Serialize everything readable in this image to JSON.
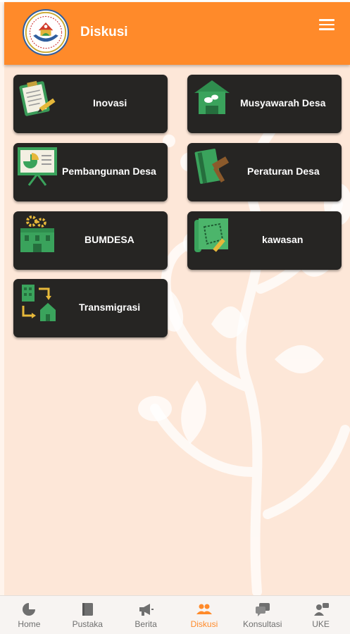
{
  "header": {
    "title": "Diskusi",
    "menu_icon": "hamburger-menu-icon",
    "logo_icon": "ministry-logo-icon"
  },
  "colors": {
    "accent": "#ff8a2a",
    "card_bg": "#262523",
    "page_bg": "#fde7d8",
    "nav_active": "#ff8a2a",
    "nav_inactive": "#6f6f6f"
  },
  "categories": [
    {
      "label": "Inovasi",
      "icon": "clipboard-pencil-icon"
    },
    {
      "label": "Musyawarah Desa",
      "icon": "village-meeting-house-icon"
    },
    {
      "label": "Pembangunan Desa",
      "icon": "presentation-chart-icon"
    },
    {
      "label": "Peraturan Desa",
      "icon": "law-book-gavel-icon"
    },
    {
      "label": "BUMDESA",
      "icon": "building-gears-icon"
    },
    {
      "label": "kawasan",
      "icon": "area-map-icon"
    },
    {
      "label": "Transmigrasi",
      "icon": "transmigration-buildings-icon"
    }
  ],
  "bottom_nav": {
    "items": [
      {
        "label": "Home",
        "icon": "pie-chart-icon"
      },
      {
        "label": "Pustaka",
        "icon": "book-icon"
      },
      {
        "label": "Berita",
        "icon": "megaphone-icon"
      },
      {
        "label": "Diskusi",
        "icon": "people-group-icon",
        "active": true
      },
      {
        "label": "Konsultasi",
        "icon": "chat-bubbles-icon"
      },
      {
        "label": "UKE",
        "icon": "users-chat-icon"
      }
    ]
  }
}
